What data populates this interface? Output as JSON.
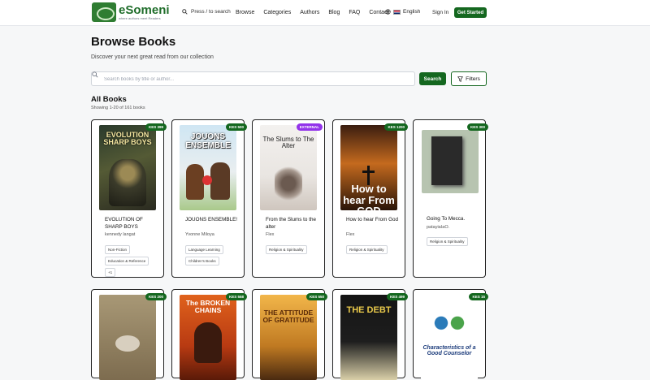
{
  "header": {
    "logo_name": "eSomeni",
    "logo_tagline": "where authors meet Readers",
    "search_hint": "Press / to search",
    "nav": [
      "Browse",
      "Categories",
      "Authors",
      "Blog",
      "FAQ",
      "Contact"
    ],
    "language": "English",
    "signin": "Sign In",
    "get_started": "Get Started"
  },
  "page": {
    "title": "Browse Books",
    "subtitle": "Discover your next great read from our collection",
    "search_placeholder": "Search books by title or author...",
    "search_button": "Search",
    "filters_button": "Filters",
    "section_title": "All Books",
    "section_count": "Showing 1-20 of 161 books"
  },
  "books": [
    {
      "title": "EVOLUTION OF SHARP BOYS",
      "author": "kennedy langat",
      "price": "KES 399",
      "tags": [
        "Non-Fiction",
        "Education & Reference",
        "+1"
      ],
      "cover_text": "EVOLUTION SHARP BOYS"
    },
    {
      "title": "JOUONS ENSEMBLE!",
      "author": "Yvonne Miloya",
      "price": "KES 500",
      "tags": [
        "Language Learning",
        "Children's Books"
      ],
      "cover_text": "JOUONS ENSEMBLE"
    },
    {
      "title": "From the Slums to the alter",
      "author": "Flex",
      "badge": "EXTERNAL",
      "tags": [
        "Religion & Spirituality"
      ],
      "cover_text": "The Slums to The Alter"
    },
    {
      "title": "How to hear From God",
      "author": "Flex",
      "price": "KES 1200",
      "tags": [
        "Religion & Spirituality"
      ],
      "cover_text": "How to hear From GOD"
    },
    {
      "title": "Going To Mecca.",
      "author": "patayiaIaO.",
      "price": "KES 300",
      "tags": [
        "Religion & Spirituality"
      ],
      "cover_text": ""
    },
    {
      "price": "KES 200",
      "cover_text": ""
    },
    {
      "price": "KES 558",
      "cover_text": "The BROKEN CHAINS"
    },
    {
      "price": "KES 550",
      "cover_text": "THE ATTITUDE OF GRATITUDE"
    },
    {
      "price": "KES 499",
      "cover_text": "THE DEBT"
    },
    {
      "price": "KES 15",
      "cover_text": "Characteristics of a Good Counselor"
    }
  ]
}
